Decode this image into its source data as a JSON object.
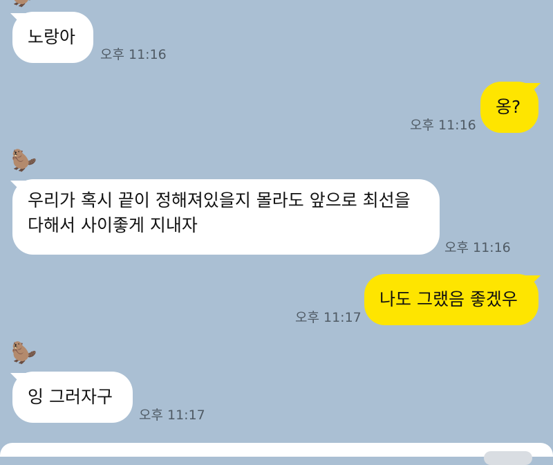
{
  "chat": {
    "messages": [
      {
        "side": "left",
        "text": "노랑아",
        "time": "오후 11:16"
      },
      {
        "side": "right",
        "text": "옹?",
        "time": "오후 11:16"
      },
      {
        "side": "left",
        "avatar": "🦫",
        "line1": "우리가 혹시 끝이 정해져있을지 몰라도 앞으로 최선을",
        "line2": "다해서 사이좋게 지내자",
        "time": "오후 11:16"
      },
      {
        "side": "right",
        "text": "나도 그랬음 좋겠우",
        "time": "오후 11:17"
      },
      {
        "side": "left",
        "avatar": "🦫",
        "text": "잉 그러자구",
        "time": "오후 11:17"
      }
    ]
  },
  "icons": {
    "avatar": "beaver-icon"
  },
  "colors": {
    "background": "#aabfd3",
    "incoming_bubble": "#ffffff",
    "outgoing_bubble": "#fee500",
    "timestamp": "#4f5a64"
  }
}
